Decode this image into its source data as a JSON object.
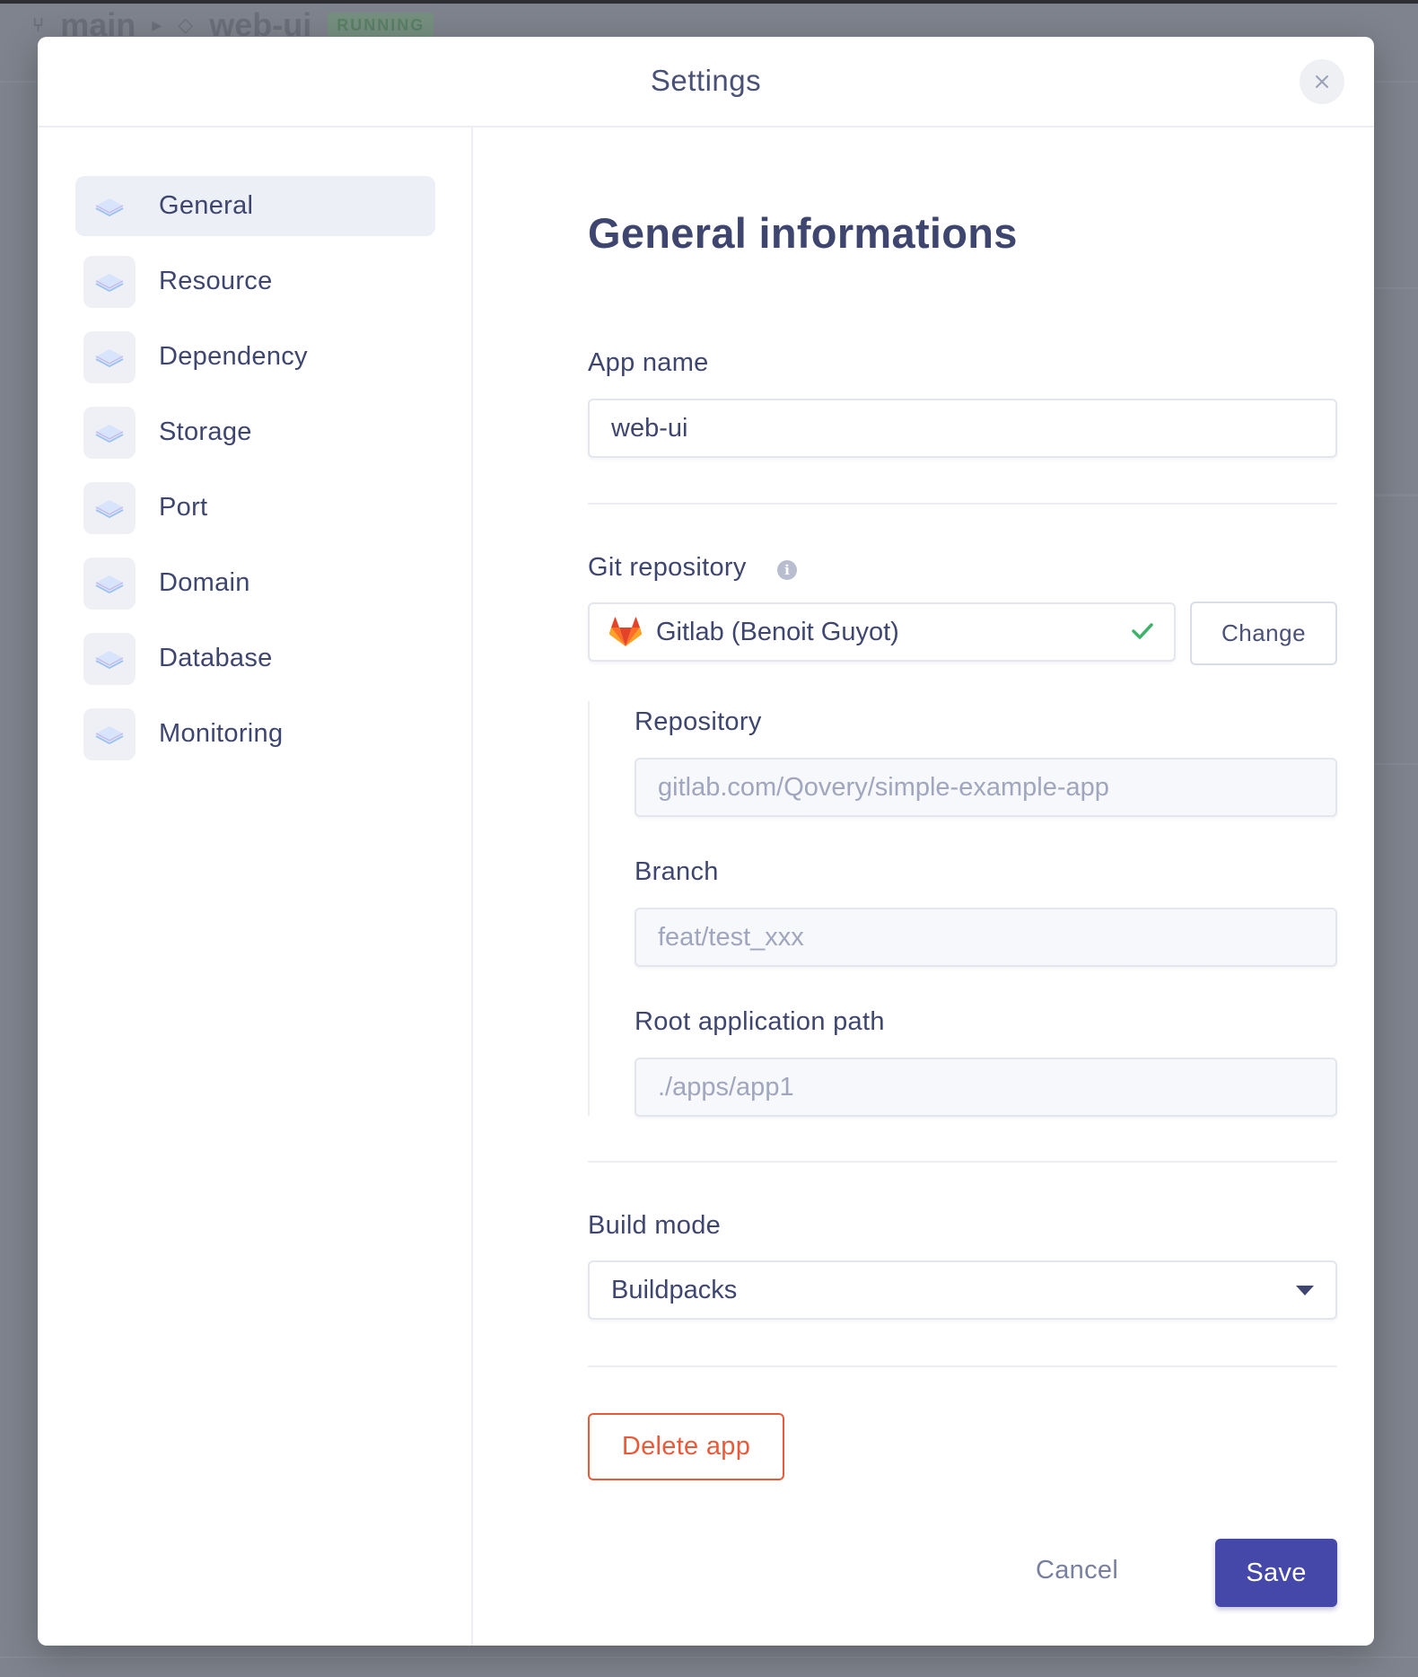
{
  "background": {
    "breadcrumb": {
      "branch": "main",
      "app": "web-ui",
      "status": "RUNNING"
    }
  },
  "modal": {
    "title": "Settings",
    "close_icon": "close-icon"
  },
  "sidebar": {
    "items": [
      {
        "label": "General",
        "icon": "layers-icon",
        "active": true
      },
      {
        "label": "Resource",
        "icon": "layers-icon"
      },
      {
        "label": "Dependency",
        "icon": "layers-icon"
      },
      {
        "label": "Storage",
        "icon": "layers-icon"
      },
      {
        "label": "Port",
        "icon": "layers-icon"
      },
      {
        "label": "Domain",
        "icon": "layers-icon"
      },
      {
        "label": "Database",
        "icon": "layers-icon"
      },
      {
        "label": "Monitoring",
        "icon": "layers-icon"
      }
    ]
  },
  "main": {
    "section_title": "General informations",
    "app_name": {
      "label": "App name",
      "value": "web-ui"
    },
    "git": {
      "label": "Git repository",
      "info_icon": "i",
      "provider_value": "Gitlab (Benoit Guyot)",
      "change_label": "Change",
      "repository": {
        "label": "Repository",
        "placeholder": "gitlab.com/Qovery/simple-example-app"
      },
      "branch": {
        "label": "Branch",
        "placeholder": "feat/test_xxx"
      },
      "root_path": {
        "label": "Root application path",
        "placeholder": "./apps/app1"
      }
    },
    "build_mode": {
      "label": "Build mode",
      "value": "Buildpacks"
    },
    "delete_label": "Delete app",
    "cancel_label": "Cancel",
    "save_label": "Save"
  },
  "colors": {
    "accent": "#4548a8",
    "danger": "#e85a3a",
    "success": "#3fb26b",
    "text": "#3e4670"
  }
}
